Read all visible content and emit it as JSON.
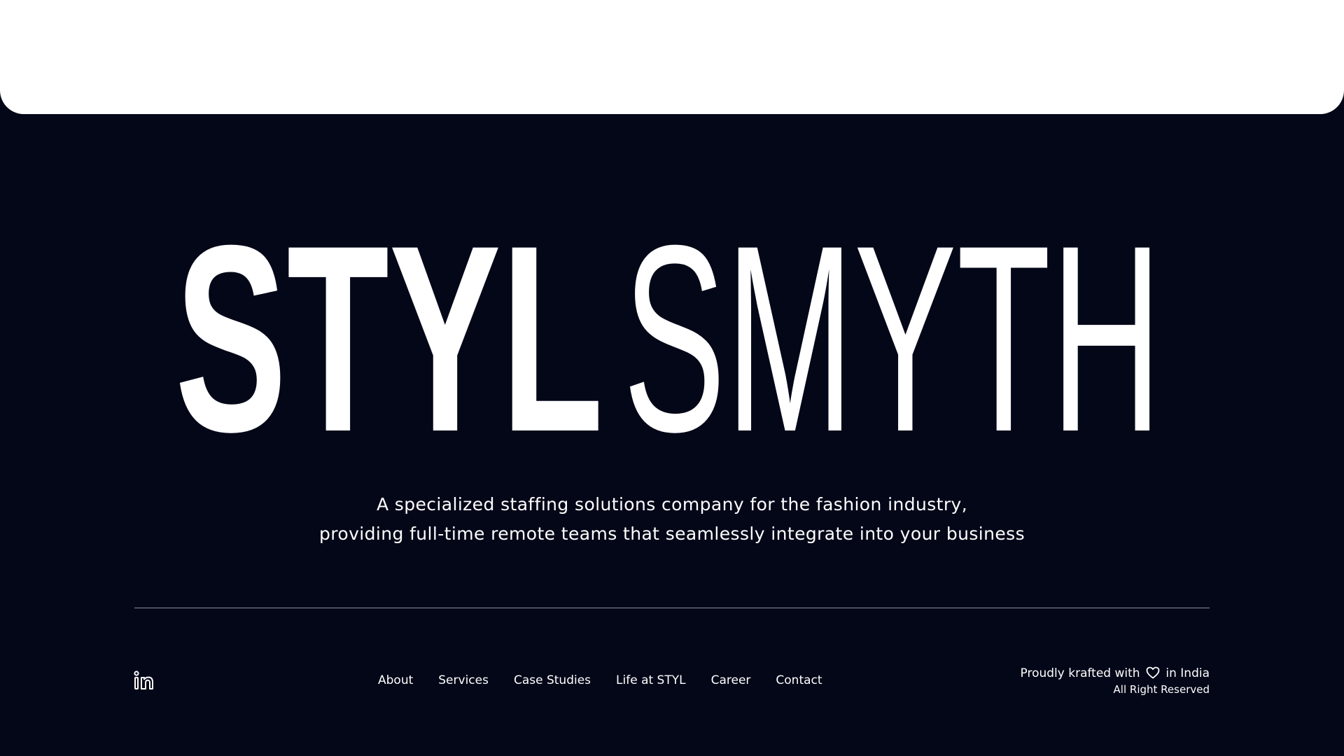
{
  "brand": {
    "wordmark_bold": "STYL",
    "wordmark_light": "SMYTH"
  },
  "tagline": {
    "line1": "A specialized staffing solutions company for the fashion industry,",
    "line2": "providing full-time remote teams that seamlessly integrate into your business"
  },
  "footer": {
    "social_icon": "linkedin-icon",
    "nav": [
      {
        "label": "About"
      },
      {
        "label": "Services"
      },
      {
        "label": "Case Studies"
      },
      {
        "label": "Life at STYL"
      },
      {
        "label": "Career"
      },
      {
        "label": "Contact"
      }
    ],
    "credit_prefix": "Proudly krafted with",
    "credit_icon": "heart-icon",
    "credit_suffix": "in India",
    "rights": "All Right Reserved"
  },
  "colors": {
    "background": "#030718",
    "top_panel": "#ffffff",
    "text": "#ffffff",
    "divider": "#8d909c"
  }
}
